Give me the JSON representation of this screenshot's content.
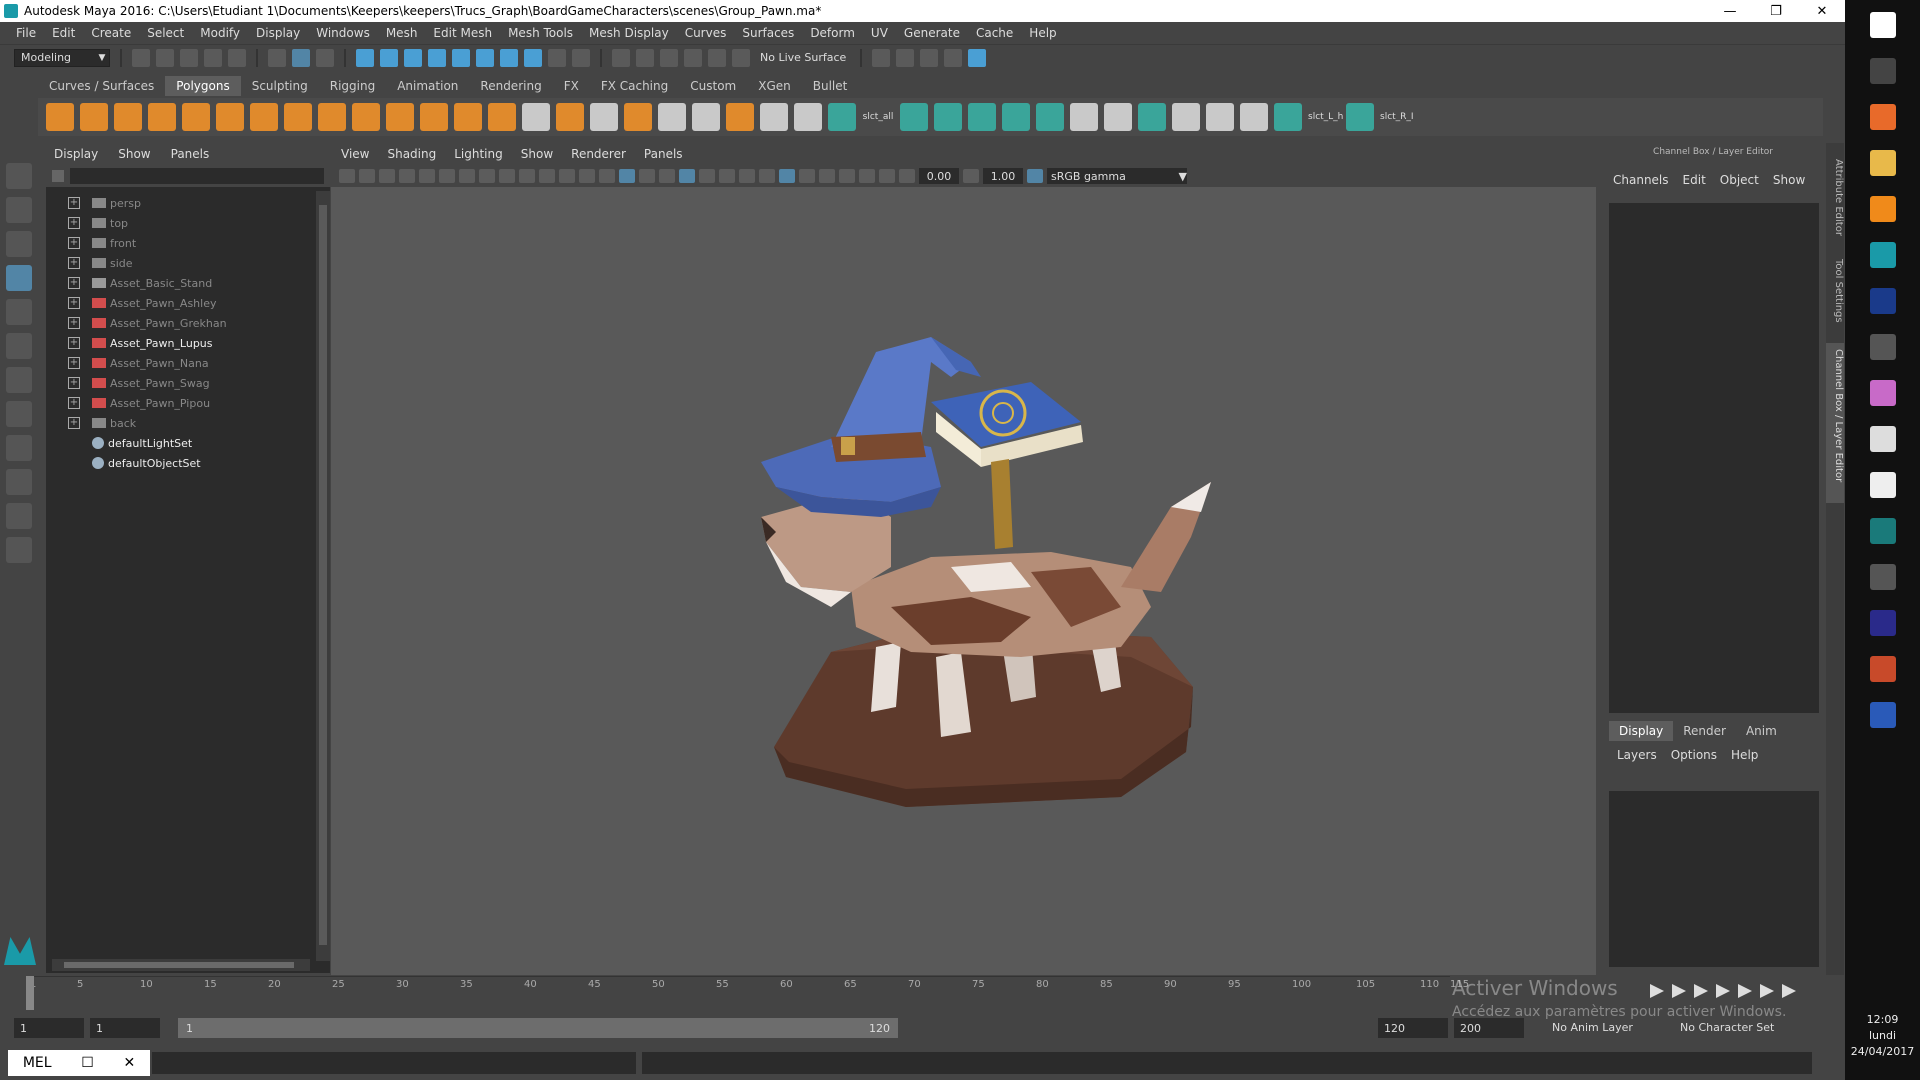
{
  "window": {
    "title": "Autodesk Maya 2016: C:\\Users\\Etudiant 1\\Documents\\Keepers\\keepers\\Trucs_Graph\\BoardGameCharacters\\scenes\\Group_Pawn.ma*",
    "minimize": "—",
    "restore": "❐",
    "close": "✕"
  },
  "menubar": [
    "File",
    "Edit",
    "Create",
    "Select",
    "Modify",
    "Display",
    "Windows",
    "Mesh",
    "Edit Mesh",
    "Mesh Tools",
    "Mesh Display",
    "Curves",
    "Surfaces",
    "Deform",
    "UV",
    "Generate",
    "Cache",
    "Help"
  ],
  "statusline": {
    "mode": "Modeling",
    "live_surface": "No Live Surface"
  },
  "shelf": {
    "tabs": [
      "Curves / Surfaces",
      "Polygons",
      "Sculpting",
      "Rigging",
      "Animation",
      "Rendering",
      "FX",
      "FX Caching",
      "Custom",
      "XGen",
      "Bullet"
    ],
    "active_tab": "Polygons",
    "script_labels": [
      "slct_all",
      "slct_L_h",
      "slct_R_I"
    ]
  },
  "outliner": {
    "menu": [
      "Display",
      "Show",
      "Panels"
    ],
    "items": [
      {
        "label": "persp",
        "type": "camera",
        "dim": true
      },
      {
        "label": "top",
        "type": "camera",
        "dim": true
      },
      {
        "label": "front",
        "type": "camera",
        "dim": true
      },
      {
        "label": "side",
        "type": "camera",
        "dim": true
      },
      {
        "label": "Asset_Basic_Stand",
        "type": "group",
        "dim": true
      },
      {
        "label": "Asset_Pawn_Ashley",
        "type": "mesh",
        "dim": true
      },
      {
        "label": "Asset_Pawn_Grekhan",
        "type": "mesh",
        "dim": true
      },
      {
        "label": "Asset_Pawn_Lupus",
        "type": "mesh",
        "dim": false
      },
      {
        "label": "Asset_Pawn_Nana",
        "type": "mesh",
        "dim": true
      },
      {
        "label": "Asset_Pawn_Swag",
        "type": "mesh",
        "dim": true
      },
      {
        "label": "Asset_Pawn_Pipou",
        "type": "mesh",
        "dim": true
      },
      {
        "label": "back",
        "type": "camera",
        "dim": true
      },
      {
        "label": "defaultLightSet",
        "type": "set",
        "dim": false
      },
      {
        "label": "defaultObjectSet",
        "type": "set",
        "dim": false
      }
    ]
  },
  "viewport": {
    "menu": [
      "View",
      "Shading",
      "Lighting",
      "Show",
      "Renderer",
      "Panels"
    ],
    "exposure": "0.00",
    "gamma": "1.00",
    "color_space": "sRGB gamma"
  },
  "channel_box": {
    "header": "Channel Box / Layer Editor",
    "menu": [
      "Channels",
      "Edit",
      "Object",
      "Show"
    ],
    "layer_tabs": [
      "Display",
      "Render",
      "Anim"
    ],
    "active_layer_tab": "Display",
    "layer_menu": [
      "Layers",
      "Options",
      "Help"
    ],
    "side_tabs": [
      "Attribute Editor",
      "Tool Settings",
      "Channel Box / Layer Editor"
    ]
  },
  "timeline": {
    "ticks": [
      "1",
      "5",
      "10",
      "15",
      "20",
      "25",
      "30",
      "35",
      "40",
      "45",
      "50",
      "55",
      "60",
      "65",
      "70",
      "75",
      "80",
      "85",
      "90",
      "95",
      "100",
      "105",
      "110",
      "115",
      "120"
    ],
    "start": "1",
    "current": "1",
    "range_start": "1",
    "range_end": "120",
    "end": "120",
    "anim_end": "200",
    "anim_layer": "No Anim Layer",
    "character_set": "No Character Set"
  },
  "watermark": {
    "line1": "Activer Windows",
    "line2": "Accédez aux paramètres pour activer Windows."
  },
  "command_line": {
    "lang": "MEL"
  },
  "taskbar": {
    "time": "12:09",
    "day": "lundi",
    "date": "24/04/2017"
  },
  "colors": {
    "accent": "#5285a6",
    "maya_teal": "#1a9aa8",
    "viewport_bg": "#595959"
  }
}
